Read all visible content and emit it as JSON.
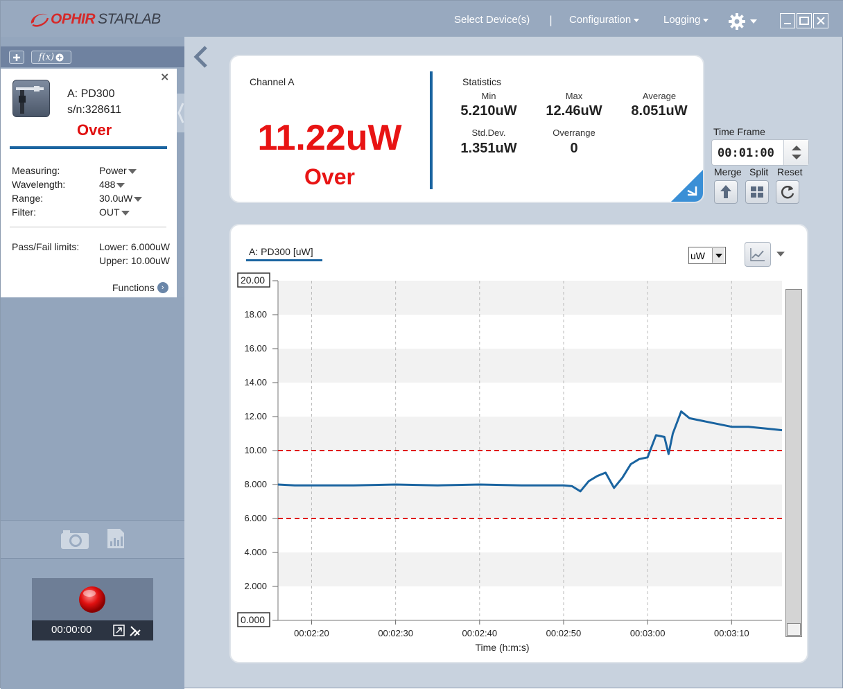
{
  "app": {
    "logo_ophir": "OPHIR",
    "logo_starlab": "STARLAB",
    "menu": {
      "select_devices": "Select Device(s)",
      "separator": "|",
      "configuration": "Configuration",
      "logging": "Logging"
    }
  },
  "sidebar": {
    "toolbar": {
      "add_icon": "plus-icon",
      "fx_label": "f(x)"
    },
    "device": {
      "name": "A: PD300",
      "serial": "s/n:328611",
      "status": "Over",
      "close": "×",
      "properties": [
        {
          "label": "Measuring:",
          "value": "Power"
        },
        {
          "label": "Wavelength:",
          "value": "488"
        },
        {
          "label": "Range:",
          "value": "30.0uW"
        },
        {
          "label": "Filter:",
          "value": "OUT"
        }
      ],
      "limits_label": "Pass/Fail limits:",
      "lower_limit": "Lower: 6.000uW",
      "upper_limit": "Upper: 10.00uW",
      "functions_label": "Functions"
    },
    "recorder": {
      "time": "00:00:00"
    }
  },
  "channel": {
    "title": "Channel A",
    "reading": "11.22uW",
    "status": "Over",
    "statistics_title": "Statistics",
    "stats": {
      "min_label": "Min",
      "min_value": "5.210uW",
      "max_label": "Max",
      "max_value": "12.46uW",
      "avg_label": "Average",
      "avg_value": "8.051uW",
      "std_label": "Std.Dev.",
      "std_value": "1.351uW",
      "over_label": "Overrange",
      "over_value": "0"
    }
  },
  "timeframe": {
    "label": "Time Frame",
    "value": "00:01:00",
    "merge": "Merge",
    "split": "Split",
    "reset": "Reset"
  },
  "graph": {
    "title": "A: PD300 [uW]",
    "unit_select": "uW",
    "colors": {
      "line": "#1a64a0",
      "limit": "#e01010",
      "band": "#f2f2f2"
    }
  },
  "chart_data": {
    "type": "line",
    "xlabel": "Time (h:m:s)",
    "ylabel": "",
    "ylim": [
      0,
      20
    ],
    "xlim": [
      "00:02:16",
      "00:03:16"
    ],
    "y_ticks": [
      "20.00",
      "18.00",
      "16.00",
      "14.00",
      "12.00",
      "10.00",
      "8.000",
      "6.000",
      "4.000",
      "2.000",
      "0.000"
    ],
    "x_ticks": [
      "00:02:20",
      "00:02:30",
      "00:02:40",
      "00:02:50",
      "00:03:00",
      "00:03:10"
    ],
    "limits": {
      "lower": 6.0,
      "upper": 10.0
    },
    "series": [
      {
        "x": [
          "00:02:16",
          "00:02:18",
          "00:02:20",
          "00:02:25",
          "00:02:30",
          "00:02:35",
          "00:02:40",
          "00:02:45",
          "00:02:50",
          "00:02:51",
          "00:02:52",
          "00:02:53",
          "00:02:54",
          "00:02:55",
          "00:02:56",
          "00:02:57",
          "00:02:58",
          "00:02:59",
          "00:03:00",
          "00:03:01",
          "00:03:02",
          "00:03:02.5",
          "00:03:03",
          "00:03:04",
          "00:03:05",
          "00:03:06",
          "00:03:08",
          "00:03:10",
          "00:03:12",
          "00:03:14",
          "00:03:16"
        ],
        "y": [
          8.0,
          7.95,
          7.95,
          7.95,
          8.0,
          7.95,
          8.0,
          7.95,
          7.95,
          7.9,
          7.6,
          8.2,
          8.5,
          8.7,
          7.8,
          8.4,
          9.2,
          9.5,
          9.6,
          10.9,
          10.8,
          9.8,
          11.0,
          12.3,
          11.9,
          11.8,
          11.6,
          11.4,
          11.4,
          11.3,
          11.2
        ]
      }
    ]
  }
}
